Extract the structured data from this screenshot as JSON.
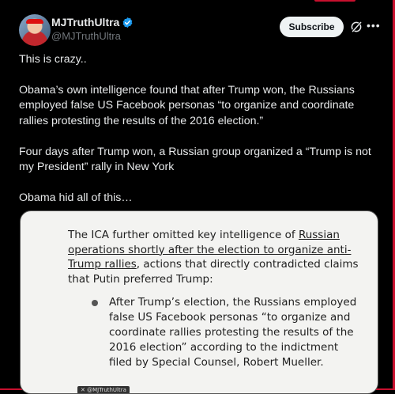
{
  "author": {
    "display_name": "MJTruthUltra",
    "handle": "@MJTruthUltra",
    "verified": true
  },
  "actions": {
    "subscribe_label": "Subscribe",
    "grok_icon": "grok-slash-icon",
    "more_icon": "more-horizontal-icon"
  },
  "post": {
    "paragraphs": [
      "This is crazy..",
      "Obama’s own intelligence found that after Trump won, the Russians employed false US Facebook personas “to organize and coordinate rallies protesting the results of the 2016 election.”",
      "Four days after Trump won, a Russian group organized a “Trump is not my President” rally in New York",
      "Obama hid all of this…"
    ]
  },
  "media": {
    "para_plain_1": "The ICA further omitted key intelligence of ",
    "para_underlined": "Russian operations shortly after the election to organize anti-Trump rallies",
    "para_plain_2": ", actions that directly contradicted claims that Putin preferred Trump:",
    "bullet_text": "After Trump’s election, the Russians employed false US Facebook personas “to organize and coordinate rallies protesting the results of the 2016 election” according to the indictment filed by Special Counsel, Robert Mueller.",
    "watermark": "✕ @MJTruthUltra"
  },
  "colors": {
    "background": "#000000",
    "text": "#e7e9ea",
    "muted": "#71767b",
    "verified": "#1d9bf0",
    "frame_accent": "#c8102e"
  }
}
